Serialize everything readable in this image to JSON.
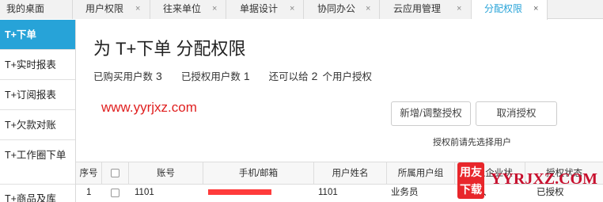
{
  "tabs": [
    {
      "label": "我的桌面",
      "closable": false
    },
    {
      "label": "用户权限",
      "closable": true
    },
    {
      "label": "往来单位",
      "closable": true
    },
    {
      "label": "单据设计",
      "closable": true
    },
    {
      "label": "协同办公",
      "closable": true
    },
    {
      "label": "云应用管理",
      "closable": true
    },
    {
      "label": "分配权限",
      "closable": true,
      "active": true
    }
  ],
  "close_glyph": "×",
  "sidebar": {
    "items": [
      {
        "label": "T+下单",
        "active": true
      },
      {
        "label": "T+实时报表"
      },
      {
        "label": "T+订阅报表"
      },
      {
        "label": "T+欠款对账"
      },
      {
        "label": "T+工作圈下单"
      },
      {
        "label": "T+商品及库"
      }
    ]
  },
  "page": {
    "title": "为 T+下单 分配权限",
    "purchased_label": "已购买用户数",
    "purchased_value": "3",
    "authorized_label": "已授权用户数",
    "authorized_value": "1",
    "remaining_prefix": "还可以给",
    "remaining_value": "2",
    "remaining_suffix": "个用户授权"
  },
  "watermark": "www.yyrjxz.com",
  "buttons": {
    "add_adjust": "新增/调整授权",
    "cancel": "取消授权"
  },
  "hint": "授权前请先选择用户",
  "table": {
    "headers": [
      "序号",
      "",
      "账号",
      "手机/邮箱",
      "用户姓名",
      "所属用户组",
      "加入企业状",
      "授权状态"
    ],
    "rows": [
      {
        "index": "1",
        "account": "1101",
        "phone_email": "",
        "username": "1101",
        "group": "业务员",
        "join_status": "已加入",
        "auth_status": "已授权"
      }
    ]
  },
  "logo": {
    "box_line1": "用友",
    "box_line2": "下载",
    "text": "YYRJXZ.COM"
  },
  "colors": {
    "accent": "#27a3d8",
    "redaction": "#ff3b3b",
    "watermark": "#e02020"
  }
}
